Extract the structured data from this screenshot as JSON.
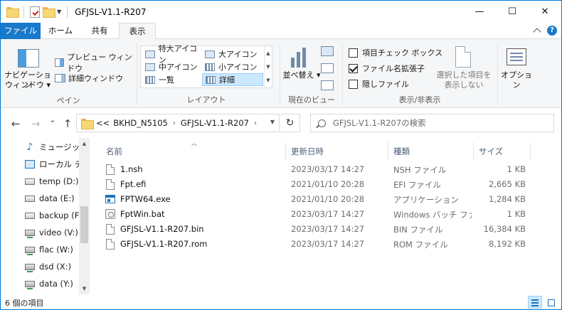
{
  "window": {
    "title": "GFJSL-V1.1-R207",
    "controls": {
      "minimize": "—",
      "maximize": "☐",
      "close": "✕"
    }
  },
  "quick_access": {
    "icons": [
      "folder-icon",
      "properties-check-icon",
      "new-folder-icon",
      "dropdown-icon"
    ]
  },
  "ribbon_tabs": [
    {
      "label": "ファイル",
      "active": false,
      "accent": "#1979ca"
    },
    {
      "label": "ホーム",
      "active": false
    },
    {
      "label": "共有",
      "active": false
    },
    {
      "label": "表示",
      "active": true
    }
  ],
  "ribbon": {
    "pane_group": {
      "nav_pane_label": "ナビゲーション",
      "nav_pane_label2": "ウィンドウ",
      "preview_label": "プレビュー ウィンドウ",
      "details_label": "詳細ウィンドウ",
      "group_label": "ペイン"
    },
    "layout_group": {
      "items": [
        {
          "label": "特大アイコン",
          "selected": false
        },
        {
          "label": "大アイコン",
          "selected": false
        },
        {
          "label": "中アイコン",
          "selected": false
        },
        {
          "label": "小アイコン",
          "selected": false
        },
        {
          "label": "一覧",
          "selected": false
        },
        {
          "label": "詳細",
          "selected": true
        }
      ],
      "group_label": "レイアウト"
    },
    "current_view_group": {
      "sort_label": "並べ替え",
      "group_label": "現在のビュー"
    },
    "show_hide_group": {
      "checkboxes": [
        {
          "label": "項目チェック ボックス",
          "checked": false
        },
        {
          "label": "ファイル名拡張子",
          "checked": true
        },
        {
          "label": "隠しファイル",
          "checked": false
        }
      ],
      "hide_selected_label": "選択した項目を",
      "hide_selected_label2": "表示しない",
      "group_label": "表示/非表示"
    },
    "options": {
      "label": "オプション"
    }
  },
  "navigation": {
    "back": "←",
    "forward": "→",
    "recent": "⌄",
    "up": "↑",
    "breadcrumb": [
      "<<",
      "BKHD_N5105",
      "GFJSL-V1.1-R207"
    ],
    "refresh": "↻",
    "search_placeholder": "GFJSL-V1.1-R207の検索"
  },
  "nav_pane": {
    "items": [
      {
        "label": "ミュージック",
        "icon": "music-icon"
      },
      {
        "label": "ローカル ディ",
        "icon": "local-disk-icon"
      },
      {
        "label": "temp (D:)",
        "icon": "drive-icon"
      },
      {
        "label": "data (E:)",
        "icon": "drive-icon"
      },
      {
        "label": "backup (F:",
        "icon": "drive-icon"
      },
      {
        "label": "video (V:)",
        "icon": "network-drive-icon"
      },
      {
        "label": "flac (W:)",
        "icon": "network-drive-icon"
      },
      {
        "label": "dsd (X:)",
        "icon": "network-drive-icon"
      },
      {
        "label": "data (Y:)",
        "icon": "network-drive-icon"
      }
    ]
  },
  "file_list": {
    "columns": [
      "名前",
      "更新日時",
      "種類",
      "サイズ"
    ],
    "rows": [
      {
        "name": "1.nsh",
        "date": "2023/03/17 14:27",
        "type": "NSH ファイル",
        "size": "1 KB",
        "icon": "file-icon"
      },
      {
        "name": "Fpt.efi",
        "date": "2021/01/10 20:28",
        "type": "EFI ファイル",
        "size": "2,665 KB",
        "icon": "file-icon"
      },
      {
        "name": "FPTW64.exe",
        "date": "2021/01/10 20:28",
        "type": "アプリケーション",
        "size": "1,284 KB",
        "icon": "exe-icon"
      },
      {
        "name": "FptWin.bat",
        "date": "2023/03/17 14:27",
        "type": "Windows バッチ ファ...",
        "size": "1 KB",
        "icon": "bat-icon"
      },
      {
        "name": "GFJSL-V1.1-R207.bin",
        "date": "2023/03/17 14:27",
        "type": "BIN ファイル",
        "size": "16,384 KB",
        "icon": "file-icon"
      },
      {
        "name": "GFJSL-V1.1-R207.rom",
        "date": "2023/03/17 14:27",
        "type": "ROM ファイル",
        "size": "8,192 KB",
        "icon": "file-icon"
      }
    ]
  },
  "status": {
    "item_count": "6 個の項目"
  }
}
